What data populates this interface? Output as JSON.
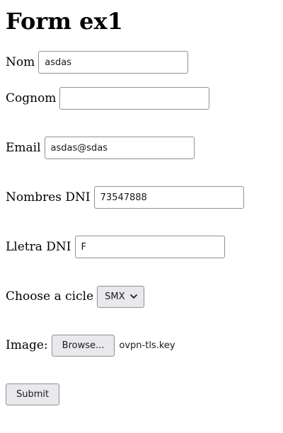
{
  "page": {
    "title": "Form ex1"
  },
  "form": {
    "nom": {
      "label": "Nom",
      "value": "asdas",
      "placeholder": ""
    },
    "cognom": {
      "label": "Cognom",
      "value": "",
      "placeholder": ""
    },
    "email": {
      "label": "Email",
      "value": "asdas@sdas",
      "placeholder": ""
    },
    "dni_numbers": {
      "label": "Nombres DNI",
      "value": "73547888",
      "placeholder": ""
    },
    "dni_letter": {
      "label": "Lletra DNI",
      "value": "F",
      "placeholder": ""
    },
    "cicle": {
      "label": "Choose a cicle",
      "selected": "SMX",
      "icon": "chevron-down-icon"
    },
    "image": {
      "label": "Image:",
      "browse_label": "Browse...",
      "filename": "ovpn-tls.key"
    },
    "submit_label": "Submit"
  }
}
